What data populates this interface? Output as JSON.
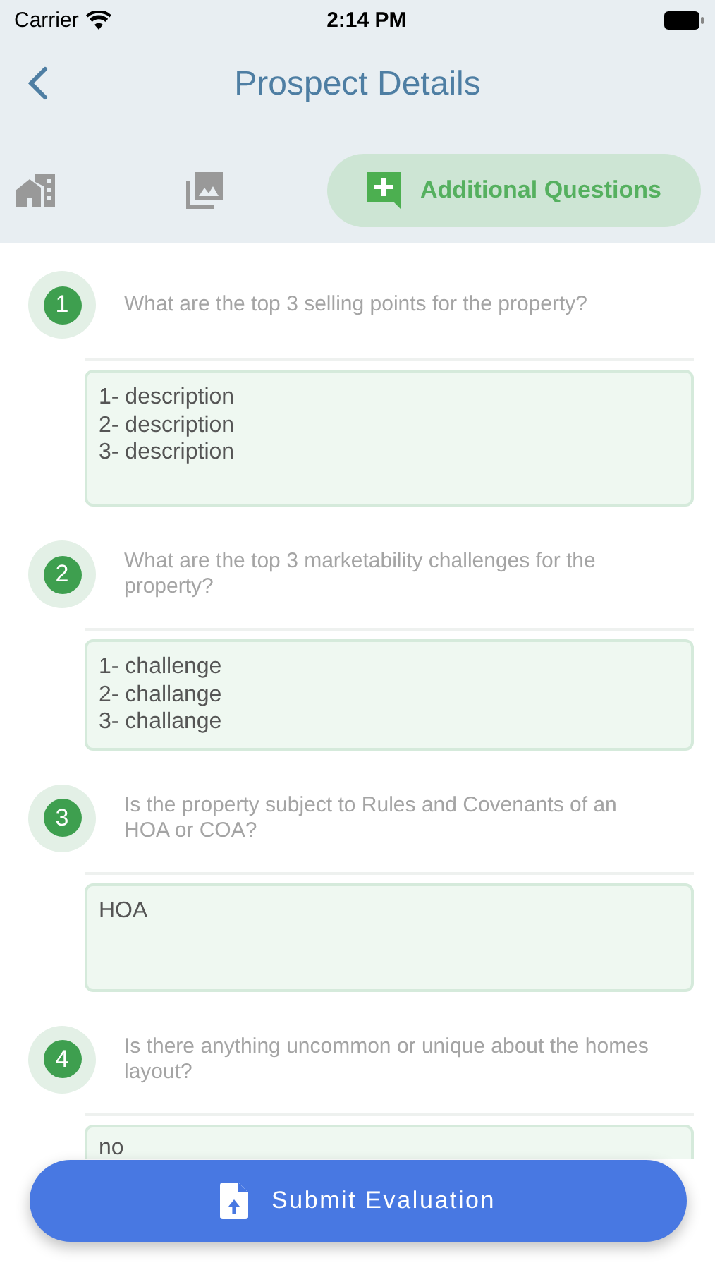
{
  "status_bar": {
    "carrier": "Carrier",
    "time": "2:14 PM"
  },
  "nav": {
    "title": "Prospect Details"
  },
  "tabs": [
    {
      "kind": "property",
      "selected": false
    },
    {
      "kind": "photos",
      "selected": false
    },
    {
      "kind": "questions",
      "label": "Additional Questions",
      "selected": true
    }
  ],
  "questions": [
    {
      "number": "1",
      "text": "What are the top 3 selling points for the property?",
      "answer": "1- description\n2- description\n3- description"
    },
    {
      "number": "2",
      "text": "What are the top 3 marketability challenges for the property?",
      "answer": "1- challenge\n2- challange\n3- challange"
    },
    {
      "number": "3",
      "text": "Is the property subject to Rules and Covenants of an HOA or COA?",
      "answer": "HOA"
    },
    {
      "number": "4",
      "text": "Is there anything uncommon or unique about the homes layout?",
      "answer": "no"
    }
  ],
  "submit_button": {
    "label": "Submit Evaluation"
  }
}
